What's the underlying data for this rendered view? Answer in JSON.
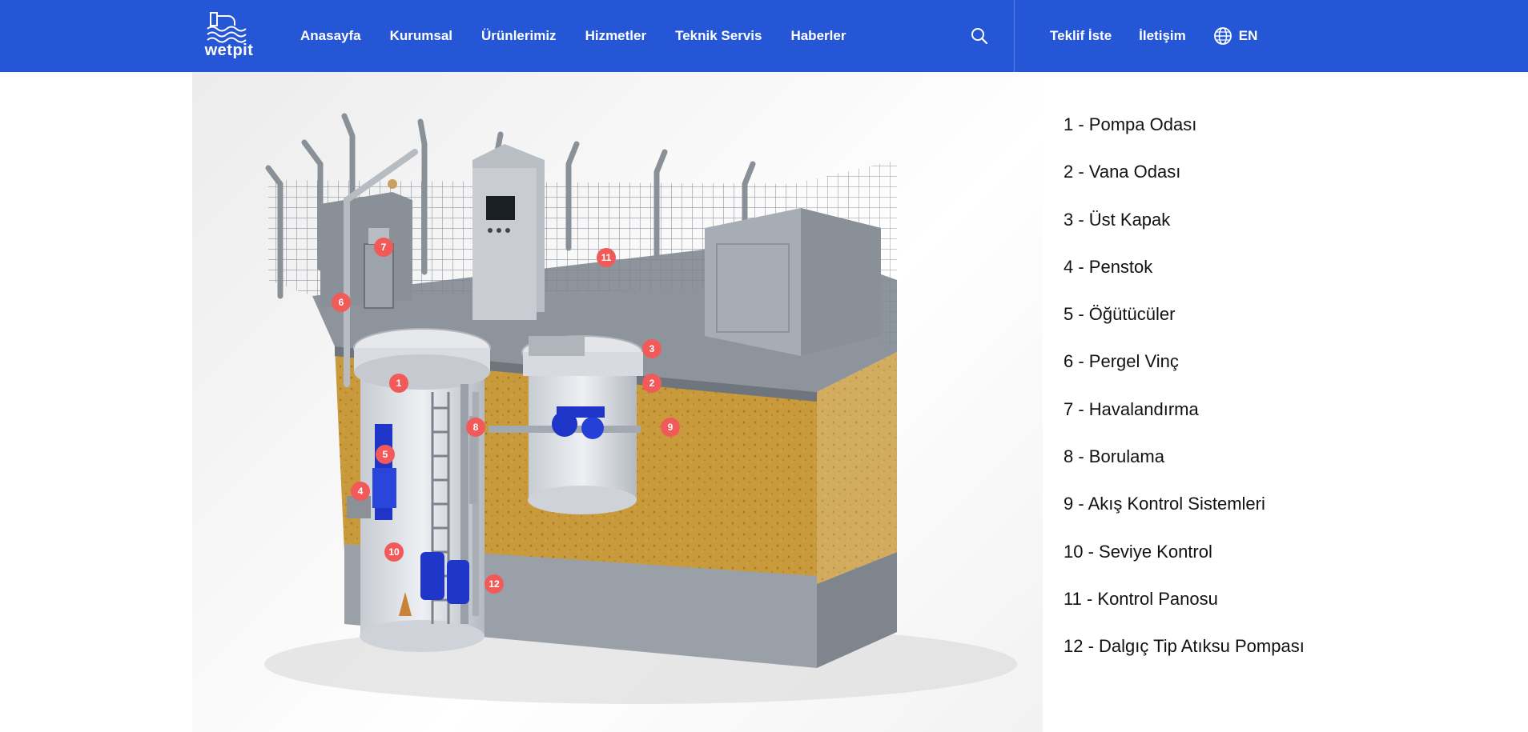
{
  "brand": {
    "name": "wetpit"
  },
  "nav": {
    "items": [
      "Anasayfa",
      "Kurumsal",
      "Ürünlerimiz",
      "Hizmetler",
      "Teknik Servis",
      "Haberler"
    ]
  },
  "header_right": {
    "quote": "Teklif İste",
    "contact": "İletişim",
    "language": "EN"
  },
  "icons": [
    "search-icon",
    "globe-icon",
    "logo-icon"
  ],
  "colors": {
    "header_bg": "#2556d6",
    "marker": "#f25a5a",
    "soil": "#c99a3c",
    "pump_blue": "#1e35c8"
  },
  "diagram": {
    "markers": [
      "1",
      "2",
      "3",
      "4",
      "5",
      "6",
      "7",
      "8",
      "9",
      "10",
      "11",
      "12"
    ]
  },
  "legend": [
    "1 - Pompa Odası",
    "2 - Vana Odası",
    "3 - Üst Kapak",
    "4 - Penstok",
    "5 - Öğütücüler",
    "6 - Pergel Vinç",
    "7 - Havalandırma",
    "8 - Borulama",
    "9 - Akış Kontrol Sistemleri",
    "10 - Seviye Kontrol",
    "11 - Kontrol Panosu",
    "12 - Dalgıç Tip Atıksu Pompası"
  ]
}
